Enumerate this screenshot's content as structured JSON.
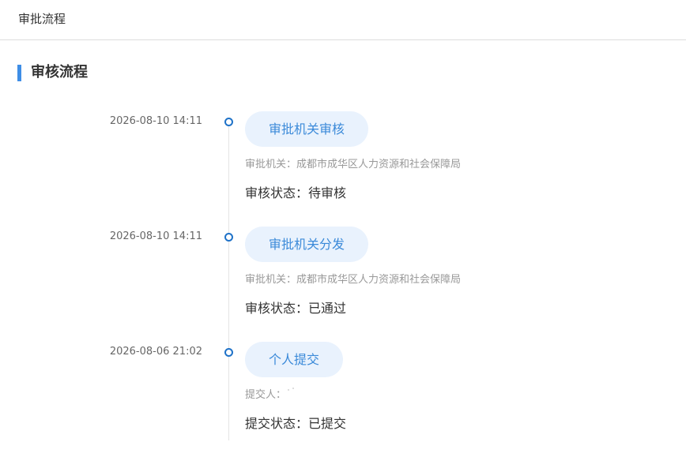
{
  "header": {
    "title": "审批流程"
  },
  "section": {
    "title": "审核流程"
  },
  "timeline": {
    "entries": [
      {
        "time": "2026-08-10 14:11",
        "step": "审批机关审核",
        "meta_label": "审批机关：",
        "meta_value": "成都市成华区人力资源和社会保障局",
        "status_label": "审核状态：",
        "status_value": "待审核"
      },
      {
        "time": "2026-08-10 14:11",
        "step": "审批机关分发",
        "meta_label": "审批机关：",
        "meta_value": "成都市成华区人力资源和社会保障局",
        "status_label": "审核状态：",
        "status_value": "已通过"
      },
      {
        "time": "2026-08-06 21:02",
        "step": "个人提交",
        "meta_label": "提交人：",
        "meta_value": "",
        "status_label": "提交状态：",
        "status_value": "已提交"
      }
    ]
  },
  "colors": {
    "accent": "#3e8ee6",
    "dot_border": "#1f72c8",
    "pill_bg": "#e9f2fd",
    "pill_text": "#3b8ad9",
    "muted_text": "#999999",
    "line": "#e4e4e4"
  }
}
